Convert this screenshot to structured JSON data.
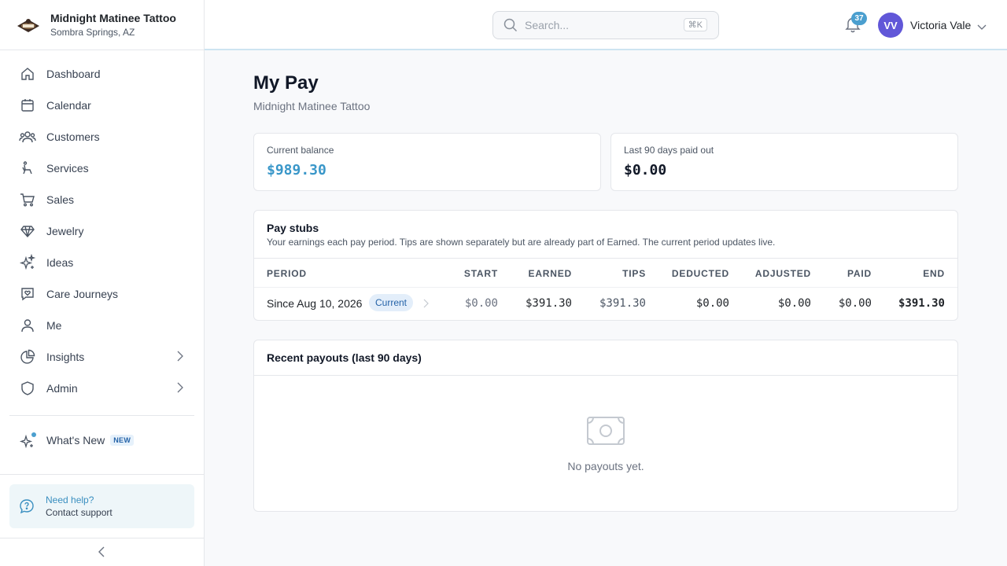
{
  "brand": {
    "name": "Midnight Matinee Tattoo",
    "location": "Sombra Springs, AZ"
  },
  "sidebar": {
    "items": [
      {
        "label": "Dashboard",
        "icon": "home-icon"
      },
      {
        "label": "Calendar",
        "icon": "calendar-icon"
      },
      {
        "label": "Customers",
        "icon": "users-icon"
      },
      {
        "label": "Services",
        "icon": "chair-icon"
      },
      {
        "label": "Sales",
        "icon": "cart-icon"
      },
      {
        "label": "Jewelry",
        "icon": "gem-icon"
      },
      {
        "label": "Ideas",
        "icon": "sparkles-icon"
      },
      {
        "label": "Care Journeys",
        "icon": "heart-chat-icon"
      },
      {
        "label": "Me",
        "icon": "person-icon"
      },
      {
        "label": "Insights",
        "icon": "pie-chart-icon"
      },
      {
        "label": "Admin",
        "icon": "shield-icon"
      }
    ],
    "whats_new": {
      "label": "What's New",
      "badge": "NEW"
    },
    "help": {
      "title": "Need help?",
      "subtitle": "Contact support"
    }
  },
  "topbar": {
    "search_placeholder": "Search...",
    "search_shortcut": "⌘K",
    "notifications_count": "37",
    "user_initials": "VV",
    "user_name": "Victoria Vale"
  },
  "page": {
    "title": "My Pay",
    "subtitle": "Midnight Matinee Tattoo"
  },
  "stats": {
    "current_balance_label": "Current balance",
    "current_balance_value": "$989.30",
    "paid_out_label": "Last 90 days paid out",
    "paid_out_value": "$0.00"
  },
  "pay_stubs": {
    "title": "Pay stubs",
    "description": "Your earnings each pay period. Tips are shown separately but are already part of Earned. The current period updates live.",
    "columns": [
      "PERIOD",
      "START",
      "EARNED",
      "TIPS",
      "DEDUCTED",
      "ADJUSTED",
      "PAID",
      "END"
    ],
    "rows": [
      {
        "period": "Since Aug 10, 2026",
        "tag": "Current",
        "start": "$0.00",
        "earned": "$391.30",
        "tips": "$391.30",
        "deducted": "$0.00",
        "adjusted": "$0.00",
        "paid": "$0.00",
        "end": "$391.30"
      }
    ]
  },
  "payouts": {
    "title": "Recent payouts (last 90 days)",
    "empty_text": "No payouts yet."
  },
  "colors": {
    "accent": "#4b9fcf",
    "avatar": "#6157d8",
    "balance": "#3a97c9"
  }
}
